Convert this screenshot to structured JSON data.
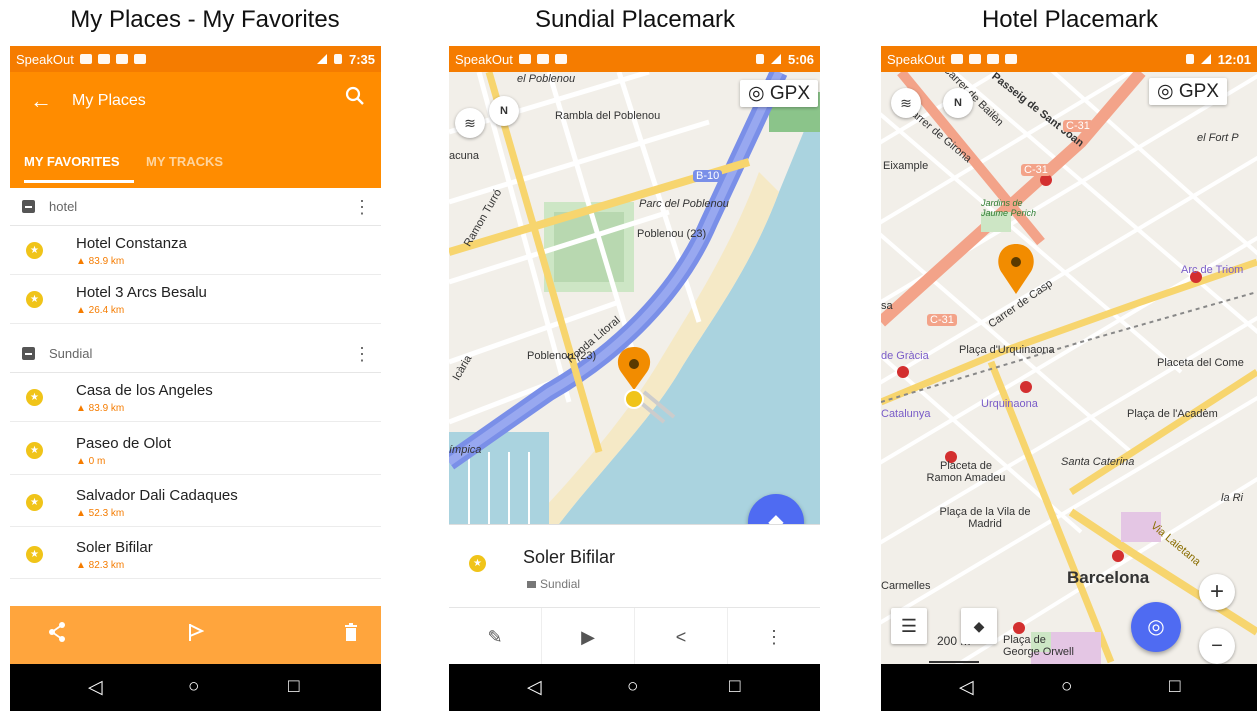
{
  "titles": {
    "p1": "My Places - My Favorites",
    "p2": "Sundial Placemark",
    "p3": "Hotel Placemark"
  },
  "p1": {
    "status": {
      "carrier": "SpeakOut",
      "time": "7:35"
    },
    "appbar": {
      "title": "My Places",
      "back_icon": "←",
      "search_icon": "⚲"
    },
    "tabs": [
      {
        "label": "MY FAVORITES"
      },
      {
        "label": "MY TRACKS"
      }
    ],
    "groups": [
      {
        "label": "hotel",
        "items": [
          {
            "name": "Hotel Constanza",
            "dist": "▲ 83.9 km"
          },
          {
            "name": "Hotel 3 Arcs Besalu",
            "dist": "▲ 26.4 km"
          }
        ]
      },
      {
        "label": "Sundial",
        "items": [
          {
            "name": "Casa de los Angeles",
            "dist": "▲ 83.9 km"
          },
          {
            "name": "Paseo de Olot",
            "dist": "▲ 0 m"
          },
          {
            "name": "Salvador Dali Cadaques",
            "dist": "▲ 52.3 km"
          },
          {
            "name": "Soler Bifilar",
            "dist": "▲ 82.3 km"
          }
        ]
      }
    ]
  },
  "p2": {
    "status": {
      "carrier": "SpeakOut",
      "time": "5:06"
    },
    "gpx": "◎ GPX",
    "labels": [
      "el Poblenou",
      "Rambla del Poblenou",
      "Parc del Poblenou",
      "Poblenou (23)",
      "Poblenou (23)",
      "Ronda Litoral",
      "B-10",
      "Ramon Turró",
      "ímpica",
      "Icària",
      "acuna"
    ],
    "card": {
      "name": "Soler Bifilar",
      "category": "Sundial"
    }
  },
  "p3": {
    "status": {
      "carrier": "SpeakOut",
      "time": "12:01"
    },
    "gpx": "◎ GPX",
    "labels": [
      "Carrer de Bailèn",
      "Passeig de Sant Joan",
      "Carrer de Girona",
      "Eixample",
      "el Fort P",
      "Jardins de Jaume Perich",
      "Carrer de Casp",
      "Arc de Triom",
      "Plaça d'Urquinaona",
      "de Gràcia",
      "Urquinaona",
      "Placeta del Come",
      "Catalunya",
      "Plaça de l'Acadèm",
      "Placeta de Ramon Amadeu",
      "Santa Caterina",
      "la Ri",
      "Plaça de la Vila de Madrid",
      "Via Laietana",
      "Barcelona",
      "Carmelles",
      "200 m",
      "Plaça de George Orwell",
      "C-31",
      "C-31",
      "C-31",
      "sa"
    ]
  },
  "navbar": {
    "back": "◁",
    "home": "○",
    "recents": "□"
  },
  "colors": {
    "orange": "#FF8C00",
    "fab": "#4F6BF2",
    "star": "#F0C419",
    "pin": "#F28C00"
  }
}
